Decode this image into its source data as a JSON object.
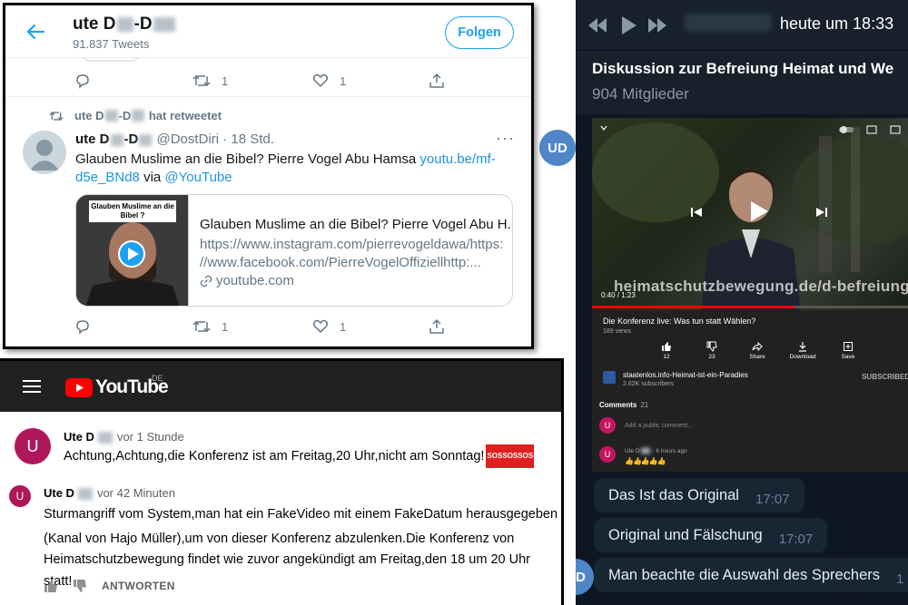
{
  "telegram": {
    "time": "heute um 18:33",
    "group_title": "Diskussion zur Befreiung Heimat und We",
    "members": "904 Mitglieder",
    "avatar_initials": "UD",
    "messages": [
      {
        "text": "Das Ist das Original",
        "time": "17:07"
      },
      {
        "text": "Original und Fälschung",
        "time": "17:07"
      },
      {
        "text": "Man beachte die Auswahl des Sprechers",
        "time": "1"
      }
    ],
    "youtube_mobile": {
      "overlay_url": "heimatschutzbewegung.de/d-befreiung",
      "video_time": "0:40 / 1:23",
      "progress": 0.64,
      "video_title": "Die Konferenz live: Was tun statt Wählen?",
      "views": "189 views",
      "actions": [
        {
          "label": "12",
          "icon": "thumb-up-icon"
        },
        {
          "label": "23",
          "icon": "thumb-down-icon"
        },
        {
          "label": "Share",
          "icon": "share-icon"
        },
        {
          "label": "Download",
          "icon": "download-icon"
        },
        {
          "label": "Save",
          "icon": "save-icon"
        }
      ],
      "channel_name": "staatenlos.info-Heimat-ist-ein-Paradies",
      "channel_subs": "2.62K subscribers",
      "subscribed": "SUBSCRIBED",
      "comments_label": "Comments",
      "comments_count": "21",
      "add_comment": "Add a public comment...",
      "comment_author": "Ute D",
      "comment_time": "6 hours ago",
      "comment_emojis": "👍👍👍👍👍",
      "avatar_letter": "U"
    }
  },
  "twitter": {
    "profile_name": "ute D",
    "profile_name_end": "-D",
    "tweet_count": "91.837 Tweets",
    "follow_label": "Folgen",
    "top_actions": {
      "retweets": "1",
      "likes": "1"
    },
    "retweet_label_a": "ute D",
    "retweet_label_b": "-D",
    "retweet_label_c": "hat retweetet",
    "tweet": {
      "name_a": "ute D",
      "name_b": "-D",
      "handle": "@DostDiri",
      "time": "· 18 Std.",
      "text_plain": "Glauben Muslime an die Bibel? Pierre Vogel Abu Hamsa ",
      "text_link": "youtu.be/mf-d5e_BNd8",
      "text_via": " via ",
      "text_mention": "@YouTube",
      "card_caption": "Glauben Muslime an die Bibel ?",
      "card_title": "Glauben Muslime an die Bibel? Pierre Vogel Abu H...",
      "card_desc1": "https://www.instagram.com/pierrevogeldawa/https:",
      "card_desc2": "//www.facebook.com/PierreVogelOffiziellhttp:...",
      "card_domain": "youtube.com",
      "retweets": "1",
      "likes": "1"
    }
  },
  "youtube": {
    "logo_text": "YouTube",
    "region": "DE",
    "comment1": {
      "avatar": "U",
      "author": "Ute D",
      "time": "vor 1 Stunde",
      "text": "Achtung,Achtung,die Konferenz ist am Freitag,20 Uhr,nicht am Sonntag!",
      "badge": "SOSSOSSOS"
    },
    "comment2": {
      "avatar": "U",
      "author": "Ute D",
      "time": "vor 42 Minuten",
      "line1": "Sturmangriff vom System,man hat ein FakeVideo mit einem FakeDatum herausgegeben",
      "line2": "(Kanal von Hajo Müller),um von dieser Konferenz abzulenken.Die Konferenz von",
      "line3": "Heimatschutzbewegung findet wie zuvor angekündigt am Freitag,den 18 um 20 Uhr statt!",
      "reply_label": "ANTWORTEN"
    }
  }
}
